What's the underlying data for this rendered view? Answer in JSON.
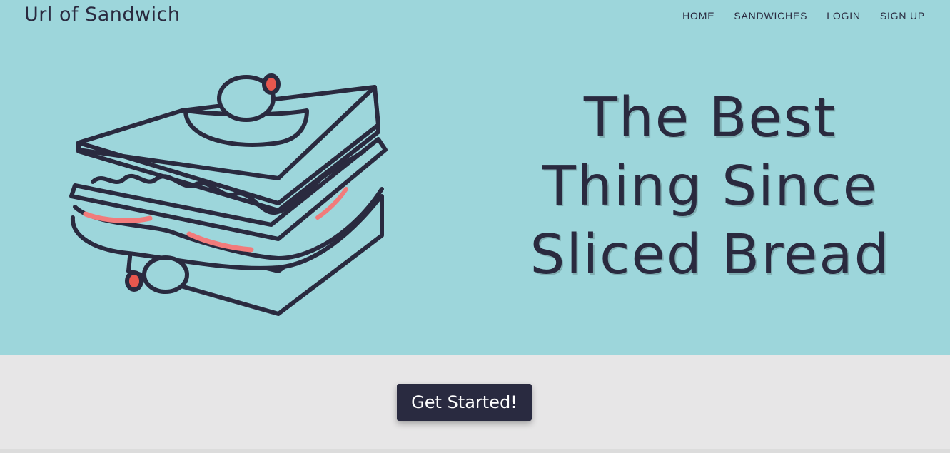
{
  "header": {
    "brand": "Url of Sandwich",
    "nav": [
      {
        "label": "HOME"
      },
      {
        "label": "SANDWICHES"
      },
      {
        "label": "LOGIN"
      },
      {
        "label": "SIGN UP"
      }
    ]
  },
  "hero": {
    "headline_lines": [
      "The Best",
      "Thing Since",
      "Sliced Bread"
    ],
    "illustration": "sandwich-illustration"
  },
  "cta": {
    "label": "Get Started!"
  },
  "colors": {
    "hero_bg": "#9dd6db",
    "page_bg": "#e7e6e7",
    "ink": "#2a2a3f",
    "button_bg": "#292a40",
    "accent_red": "#f27b7b"
  }
}
